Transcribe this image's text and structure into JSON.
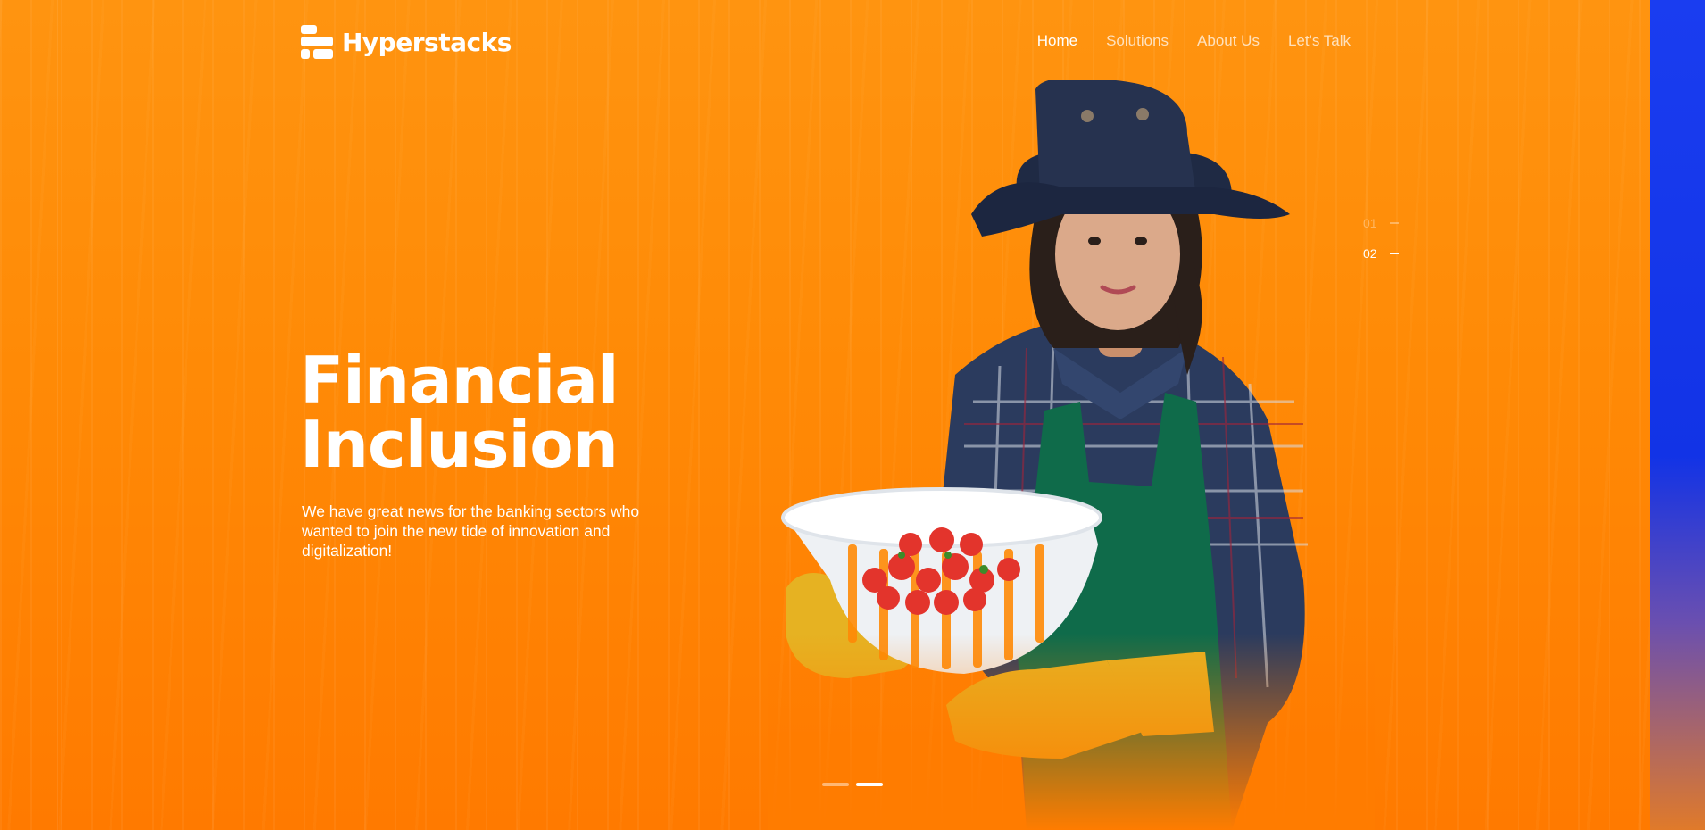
{
  "brand": {
    "name": "Hyperstacks"
  },
  "nav": {
    "items": [
      {
        "label": "Home",
        "active": true
      },
      {
        "label": "Solutions",
        "active": false
      },
      {
        "label": "About Us",
        "active": false
      },
      {
        "label": "Let's Talk",
        "active": false
      }
    ]
  },
  "hero": {
    "title_line1": "Financial",
    "title_line2": "Inclusion",
    "description": "We have great news for the banking sectors who wanted to join the new tide of innovation and digitalization!"
  },
  "slides": {
    "items": [
      {
        "label": "01"
      },
      {
        "label": "02"
      }
    ],
    "current": 2,
    "count": 2
  },
  "colors": {
    "accent_orange": "#ff8a00",
    "side_strip_blue": "#1a3df0"
  },
  "illustration": {
    "icon": "farmer-woman-with-strawberry-basket"
  }
}
